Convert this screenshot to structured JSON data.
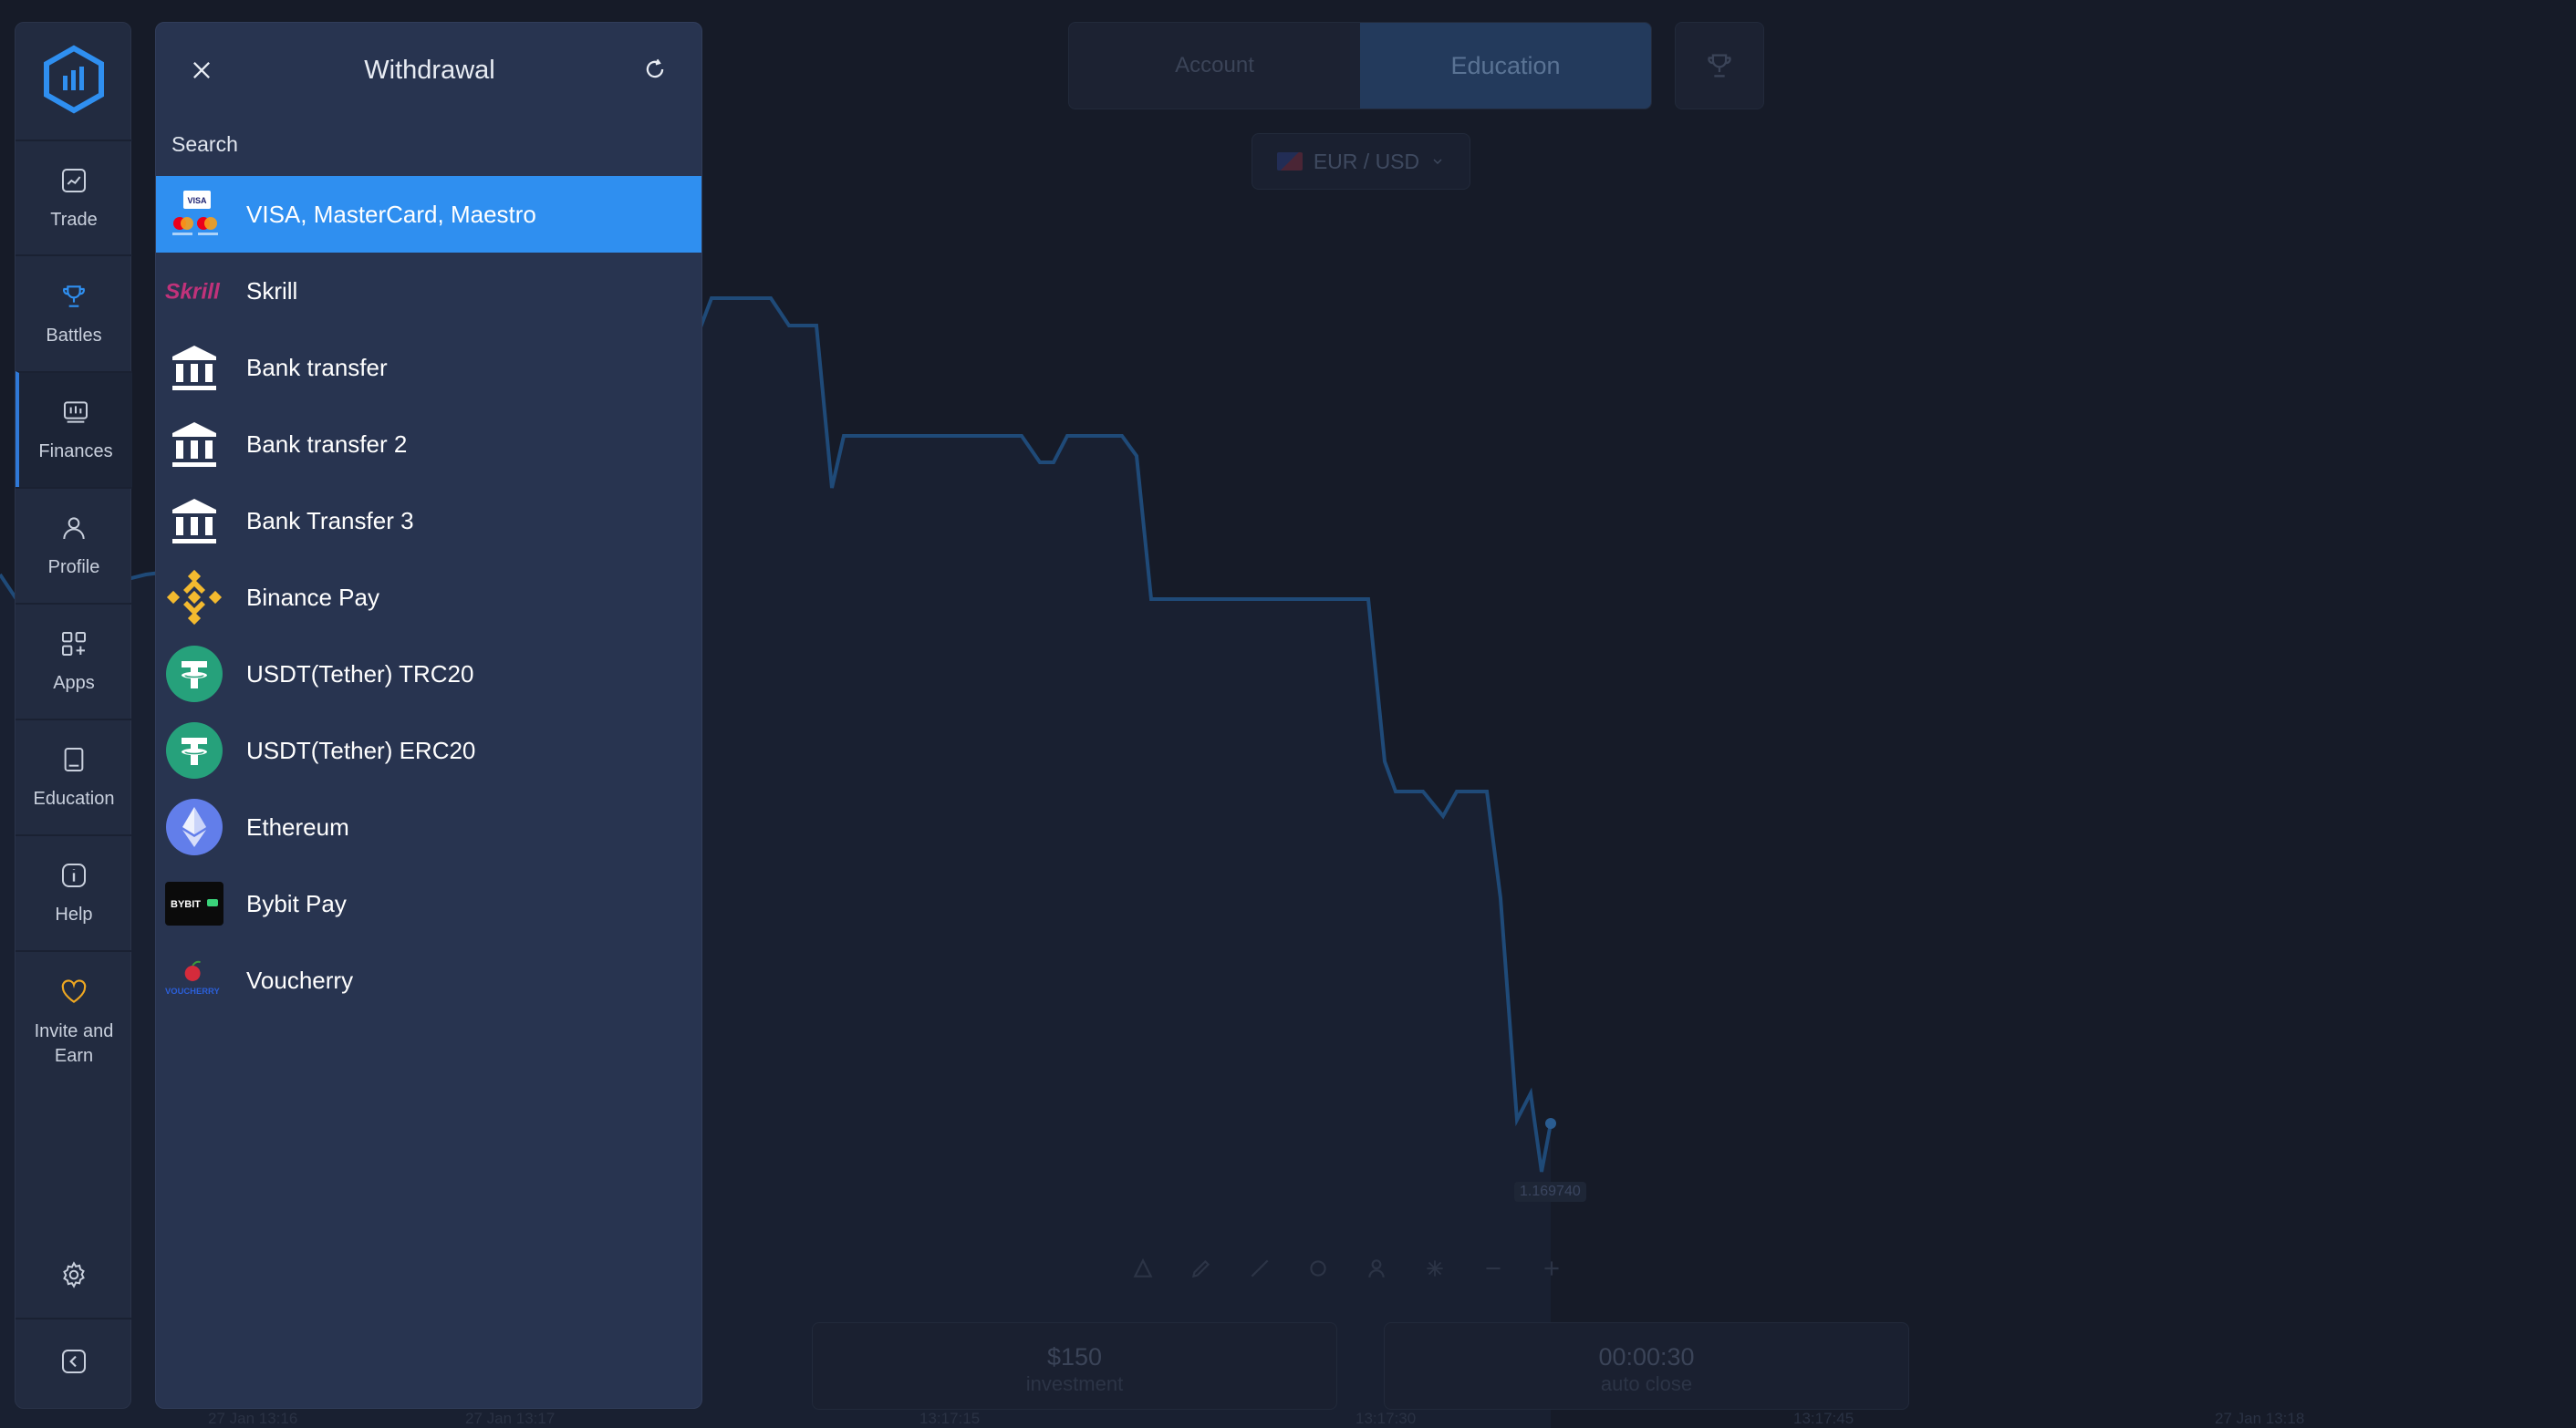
{
  "top_tabs": {
    "account": "Account",
    "education": "Education"
  },
  "pair": {
    "label": "EUR / USD"
  },
  "sidebar": {
    "items": [
      {
        "label": "Trade",
        "icon": "chart-line-icon"
      },
      {
        "label": "Battles",
        "icon": "trophy-icon"
      },
      {
        "label": "Finances",
        "icon": "finances-icon"
      },
      {
        "label": "Profile",
        "icon": "user-icon"
      },
      {
        "label": "Apps",
        "icon": "apps-icon"
      },
      {
        "label": "Education",
        "icon": "book-icon"
      },
      {
        "label": "Help",
        "icon": "info-icon"
      },
      {
        "label": "Invite and Earn",
        "icon": "heart-icon"
      }
    ]
  },
  "panel": {
    "title": "Withdrawal",
    "search_label": "Search",
    "methods": [
      {
        "label": "VISA, MasterCard, Maestro",
        "icon": "cards-icon",
        "selected": true
      },
      {
        "label": "Skrill",
        "icon": "skrill-logo-icon"
      },
      {
        "label": "Bank transfer",
        "icon": "bank-icon"
      },
      {
        "label": "Bank transfer 2",
        "icon": "bank-icon"
      },
      {
        "label": "Bank Transfer 3",
        "icon": "bank-icon"
      },
      {
        "label": "Binance Pay",
        "icon": "binance-icon"
      },
      {
        "label": "USDT(Tether) TRC20",
        "icon": "tether-icon"
      },
      {
        "label": "USDT(Tether) ERC20",
        "icon": "tether-icon"
      },
      {
        "label": "Ethereum",
        "icon": "ethereum-icon"
      },
      {
        "label": "Bybit Pay",
        "icon": "bybit-icon"
      },
      {
        "label": "Voucherry",
        "icon": "voucherry-icon"
      }
    ],
    "logos": {
      "skrill": "Skrill",
      "bybit": "BYBIT",
      "voucherry": "VOUCHERRY",
      "visa": "VISA"
    }
  },
  "trade": {
    "investment_value": "$150",
    "investment_label": "investment",
    "time_value": "00:00:30",
    "time_label": "auto close",
    "price_tag": "1.169740"
  },
  "time_axis": [
    "27 Jan 13:16",
    "27 Jan 13:17",
    "13:17:15",
    "13:17:30",
    "13:17:45",
    "27 Jan 13:18"
  ],
  "colors": {
    "accent": "#2f8ff0",
    "panel": "#283450",
    "sidebar": "#222b40",
    "background": "#161b28",
    "chart_line": "#1f4a78"
  }
}
